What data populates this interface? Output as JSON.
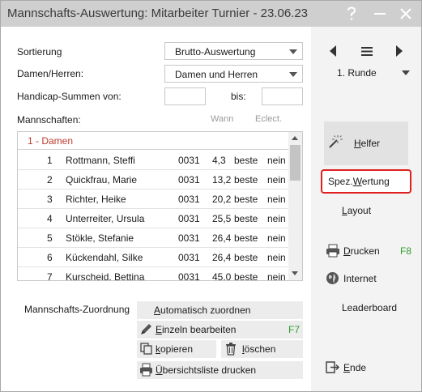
{
  "window": {
    "title": "Mannschafts-Auswertung: Mitarbeiter Turnier - 23.06.23",
    "help_icon": "question-mark-icon",
    "minimize_icon": "minimize-icon",
    "close_icon": "close-icon"
  },
  "form": {
    "sortierung_label": "Sortierung",
    "sortierung_value": "Brutto-Auswertung",
    "damen_herren_label": "Damen/Herren:",
    "damen_herren_value": "Damen und Herren",
    "handicap_label": "Handicap-Summen von:",
    "handicap_from": "",
    "bis_label": "bis:",
    "handicap_to": "",
    "mannschaften_label": "Mannschaften:",
    "col_wann": "Wann",
    "col_eclect": "Eclect."
  },
  "list": {
    "group": "1 - Damen",
    "rows": [
      {
        "nr": "1",
        "name": "Rottmann, Steffi",
        "code": "0031",
        "hcp": "4,3",
        "wann": "beste",
        "eclect": "nein"
      },
      {
        "nr": "2",
        "name": "Quickfrau, Marie",
        "code": "0031",
        "hcp": "13,2",
        "wann": "beste",
        "eclect": "nein"
      },
      {
        "nr": "3",
        "name": "Richter, Heike",
        "code": "0031",
        "hcp": "20,2",
        "wann": "beste",
        "eclect": "nein"
      },
      {
        "nr": "4",
        "name": "Unterreiter, Ursula",
        "code": "0031",
        "hcp": "25,5",
        "wann": "beste",
        "eclect": "nein"
      },
      {
        "nr": "5",
        "name": "Stökle, Stefanie",
        "code": "0031",
        "hcp": "26,4",
        "wann": "beste",
        "eclect": "nein"
      },
      {
        "nr": "6",
        "name": "Kückendahl, Silke",
        "code": "0031",
        "hcp": "26,4",
        "wann": "beste",
        "eclect": "nein"
      },
      {
        "nr": "7",
        "name": "Kurscheid, Bettina",
        "code": "0031",
        "hcp": "45,0",
        "wann": "beste",
        "eclect": "nein"
      }
    ]
  },
  "zuordnung": {
    "label": "Mannschafts-Zuordnung",
    "auto": "Automatisch zuordnen",
    "einzeln": "Einzeln bearbeiten",
    "einzeln_shortcut": "F7",
    "kopieren": "kopieren",
    "loeschen": "löschen",
    "uebersicht": "Übersichtsliste drucken"
  },
  "sidebar": {
    "runde_value": "1. Runde",
    "helfer": "Helfer",
    "spez_wertung": "Spez.Wertung",
    "layout": "Layout",
    "drucken": "Drucken",
    "drucken_shortcut": "F8",
    "internet": "Internet",
    "leaderboard": "Leaderboard",
    "ende": "Ende"
  },
  "colors": {
    "accent_green": "#2e9e2e",
    "group_red": "#c0392b",
    "highlight_red": "#e02020"
  }
}
